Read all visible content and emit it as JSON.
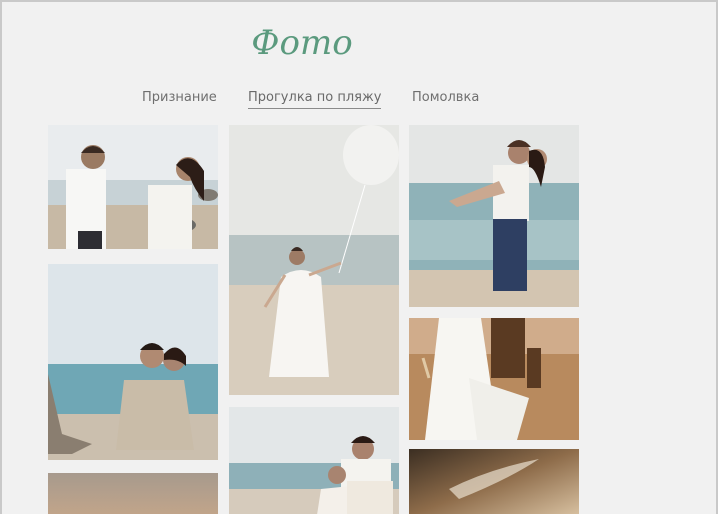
{
  "gallery": {
    "title": "Фото",
    "tabs": [
      {
        "label": "Признание",
        "active": false
      },
      {
        "label": "Прогулка по пляжу",
        "active": true
      },
      {
        "label": "Помолвка",
        "active": false
      }
    ]
  },
  "colors": {
    "background": "#f1f1f1",
    "title": "#5b9a7e",
    "tab_text": "#6f6f6f"
  }
}
